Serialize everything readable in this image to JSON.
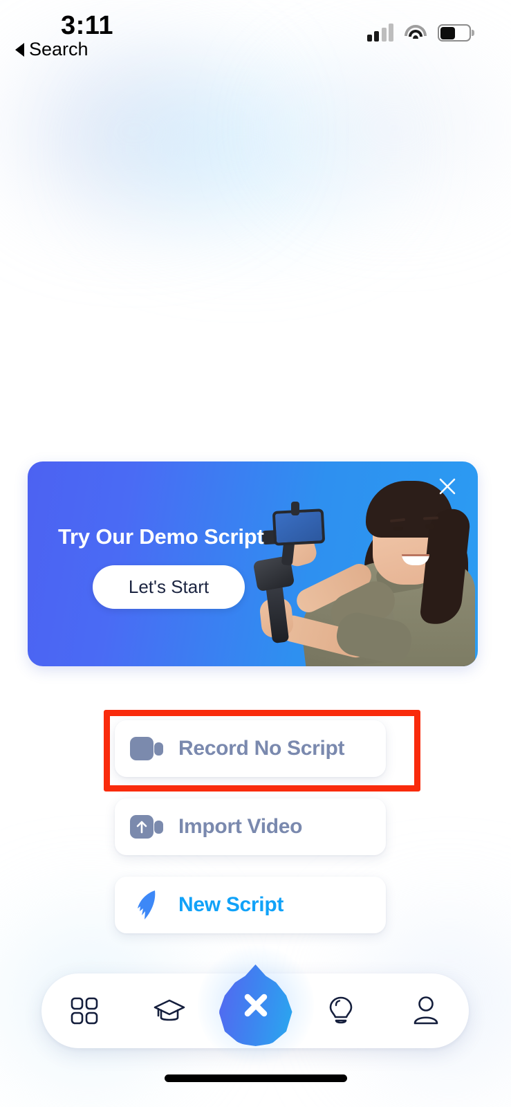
{
  "status_bar": {
    "time": "3:11",
    "back_label": "Search",
    "back_icon": "triangle-left-icon",
    "cellular_icon": "cellular-bars-icon",
    "cellular_bars_filled": 2,
    "cellular_bars_total": 4,
    "wifi_icon": "wifi-icon",
    "battery_icon": "battery-icon",
    "battery_level_percent": 45
  },
  "promo_banner": {
    "title": "Try Our Demo Script",
    "cta_label": "Let's Start",
    "close_icon": "close-x-icon",
    "illustration": "woman-holding-gimbal-with-phone",
    "gradient_start": "#4c62f2",
    "gradient_end": "#2b9cf2"
  },
  "actions": [
    {
      "label": "Record No Script",
      "icon": "video-camera-icon",
      "color": "#7a89ae",
      "highlighted": true
    },
    {
      "label": "Import Video",
      "icon": "video-camera-upload-icon",
      "color": "#7a89ae",
      "highlighted": false
    },
    {
      "label": "New Script",
      "icon": "feather-quill-icon",
      "color": "#11a2f8",
      "highlighted": false
    }
  ],
  "highlight": {
    "color": "#f92b0c",
    "target": "Record No Script"
  },
  "bottom_nav": {
    "items": [
      {
        "name": "dashboard",
        "icon": "grid-squares-icon"
      },
      {
        "name": "learn",
        "icon": "graduation-cap-icon"
      },
      {
        "name": "create",
        "icon": "droplet-x-icon"
      },
      {
        "name": "tips",
        "icon": "lightbulb-icon"
      },
      {
        "name": "profile",
        "icon": "person-icon"
      }
    ],
    "icon_color": "#141e3c",
    "fab_gradient_start": "#5566f0",
    "fab_gradient_end": "#29a8ef"
  },
  "home_indicator": "home-bar"
}
